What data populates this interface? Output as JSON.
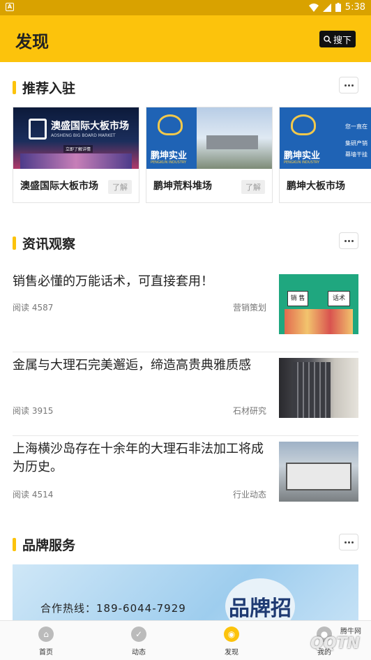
{
  "status": {
    "time": "5:38"
  },
  "header": {
    "title": "发现",
    "search_label": "搜下"
  },
  "sections": {
    "recommend": {
      "title": "推荐入驻"
    },
    "news": {
      "title": "资讯观察"
    },
    "brand": {
      "title": "品牌服务"
    }
  },
  "cards": [
    {
      "name": "澳盛国际大板市场",
      "tag": "了解",
      "banner_title": "澳盛国际大板市场",
      "banner_sub": "AOSHENG BIG BOARD MARKET",
      "banner_cta": "立即了解详情"
    },
    {
      "name": "鹏坤荒料堆场",
      "tag": "了解",
      "banner_title": "鹏坤实业",
      "banner_sub": "PENGKUN INDUSTRY"
    },
    {
      "name": "鹏坤大板市场",
      "tag": "",
      "banner_title": "鹏坤实业",
      "banner_sub": "PENGKUN INDUSTRY",
      "banner_side": [
        "您一直在",
        "集研产销",
        "幕墙干挂"
      ]
    }
  ],
  "news": [
    {
      "title": "销售必懂的万能话术，可直接套用！",
      "reads": "阅读 4587",
      "category": "营销策划",
      "thumb_signs": [
        "销 售",
        "话术"
      ]
    },
    {
      "title": "金属与大理石完美邂逅，缔造高贵典雅质感",
      "reads": "阅读 3915",
      "category": "石材研究"
    },
    {
      "title": "上海横沙岛存在十余年的大理石非法加工将成为历史。",
      "reads": "阅读 4514",
      "category": "行业动态"
    }
  ],
  "brand_banner": {
    "hotline": "合作热线：189-6044-7929",
    "big_text": "品牌招"
  },
  "tabs": [
    {
      "label": "首页",
      "icon": "home-icon"
    },
    {
      "label": "动态",
      "icon": "check-icon"
    },
    {
      "label": "发现",
      "icon": "discover-icon"
    },
    {
      "label": "我的",
      "icon": "user-icon"
    }
  ],
  "watermark": {
    "text": "腾牛网",
    "logo": "QQTN"
  },
  "colors": {
    "accent": "#fcc30c",
    "statusbar": "#d9a200"
  }
}
